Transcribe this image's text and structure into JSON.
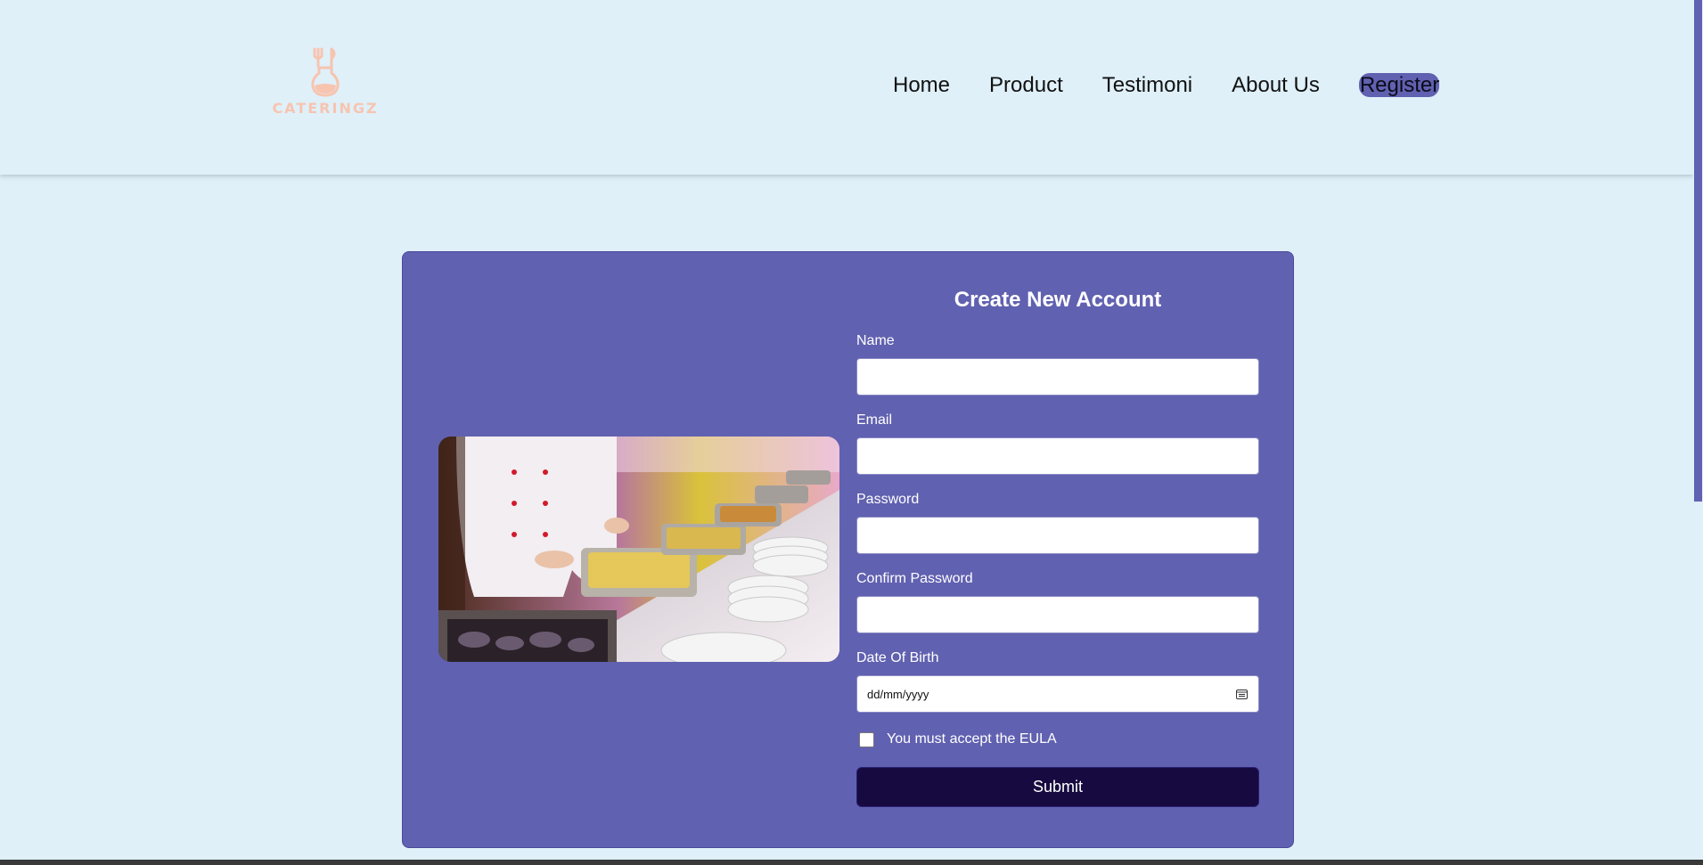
{
  "brand": {
    "logo_text": "CATERINGZ",
    "accent": "#f7c4b0"
  },
  "nav": {
    "items": [
      "Home",
      "Product",
      "Testimoni",
      "About Us"
    ],
    "register_label": "Register"
  },
  "form": {
    "title": "Create New Account",
    "name_label": "Name",
    "email_label": "Email",
    "password_label": "Password",
    "confirm_label": "Confirm Password",
    "dob_label": "Date Of Birth",
    "dob_placeholder": "dd/mm/yyyy",
    "eula_label": "You must accept the EULA",
    "submit_label": "Submit"
  },
  "colors": {
    "page_bg": "#dff0f9",
    "card_bg": "#6161b1",
    "submit_bg": "#170a40"
  }
}
